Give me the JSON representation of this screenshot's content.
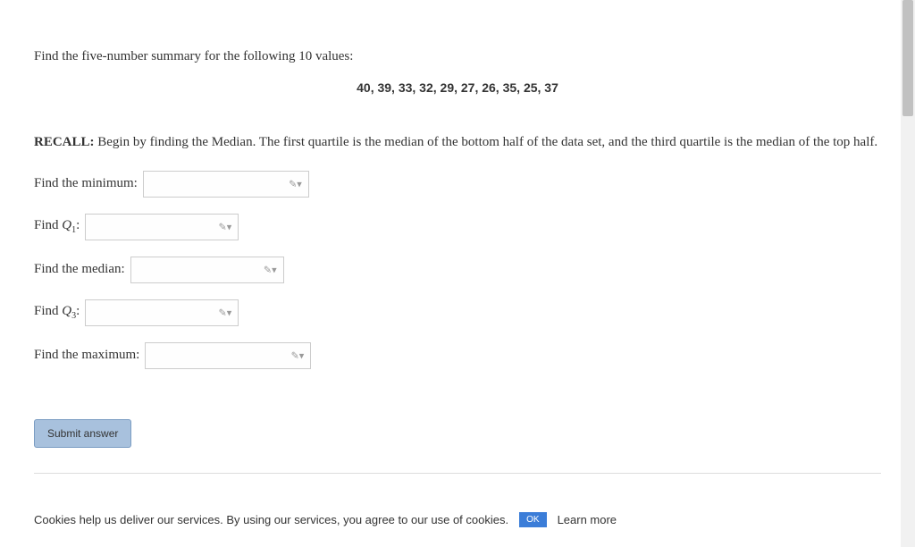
{
  "question": {
    "intro": "Find the five-number summary for the following 10 values:",
    "data_values": "40,  39,  33,  32,  29,  27,  26,  35,  25,  37",
    "recall_label": "RECALL:",
    "recall_text": " Begin by finding the Median. The first quartile is the median of the bottom half of the data set, and the third quartile is the median of the top half."
  },
  "inputs": {
    "min_label": "Find the minimum:",
    "q1_label_pre": "Find ",
    "q1_label_sym": "Q",
    "q1_label_sub": "1",
    "q1_label_post": ":",
    "median_label": "Find the median:",
    "q3_label_pre": "Find ",
    "q3_label_sym": "Q",
    "q3_label_sub": "3",
    "q3_label_post": ":",
    "max_label": "Find the maximum:"
  },
  "submit_label": "Submit answer",
  "cookies": {
    "text": "Cookies help us deliver our services. By using our services, you agree to our use of cookies.",
    "ok": "OK",
    "learn_more": "Learn more"
  }
}
